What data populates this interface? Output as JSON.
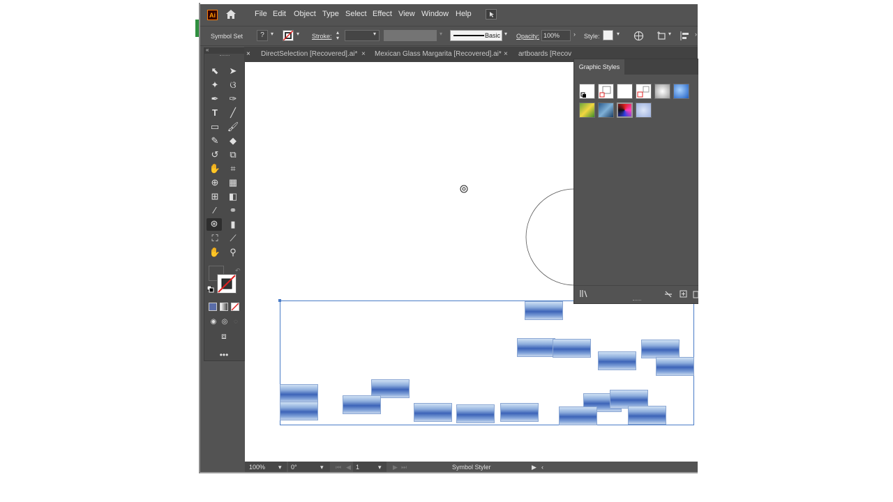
{
  "app": {
    "logo": "Ai",
    "home_icon": "home-icon"
  },
  "menu": [
    "File",
    "Edit",
    "Object",
    "Type",
    "Select",
    "Effect",
    "View",
    "Window",
    "Help"
  ],
  "control_bar": {
    "left_label": "Symbol Set",
    "fill_icon": "question-swatch-icon",
    "stroke_label": "Stroke:",
    "brush_label": "Basic",
    "opacity_label": "Opacity:",
    "opacity_value": "100%",
    "style_label": "Style:"
  },
  "tabs": [
    {
      "label": "DirectSelection [Recovered].ai*"
    },
    {
      "label": "Mexican Glass Margarita [Recovered].ai*"
    },
    {
      "label": "artboards [Recov"
    }
  ],
  "panel": {
    "title": "Graphic Styles"
  },
  "status_bar": {
    "zoom": "100%",
    "rotation": "0°",
    "artboard": "1",
    "tool_name": "Symbol Styler"
  },
  "colors": {
    "app_bg": "#535353",
    "selection": "#4a7cc7",
    "accent": "#ff7c00"
  }
}
